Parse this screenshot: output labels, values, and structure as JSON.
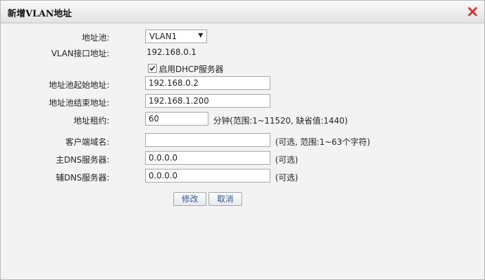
{
  "dialog": {
    "title": "新增VLAN地址"
  },
  "form": {
    "pool": {
      "label": "地址池:",
      "selected": "VLAN1"
    },
    "vlan_ip": {
      "label": "VLAN接口地址:",
      "value": "192.168.0.1"
    },
    "dhcp": {
      "label": "启用DHCP服务器",
      "checked": true
    },
    "start": {
      "label": "地址池起始地址:",
      "value": "192.168.0.2"
    },
    "end": {
      "label": "地址池结束地址:",
      "value": "192.168.1.200"
    },
    "lease": {
      "label": "地址租约:",
      "value": "60",
      "hint": "分钟(范围:1~11520, 缺省值:1440)"
    },
    "domain": {
      "label": "客户端域名:",
      "value": "",
      "hint": "(可选, 范围:1~63个字符)"
    },
    "dns1": {
      "label": "主DNS服务器:",
      "value": "0.0.0.0",
      "hint": "(可选)"
    },
    "dns2": {
      "label": "辅DNS服务器:",
      "value": "0.0.0.0",
      "hint": "(可选)"
    }
  },
  "buttons": {
    "modify": "修改",
    "cancel": "取消"
  },
  "colors": {
    "close_icon": "#d9342b",
    "button_text": "#2c5aa0"
  }
}
